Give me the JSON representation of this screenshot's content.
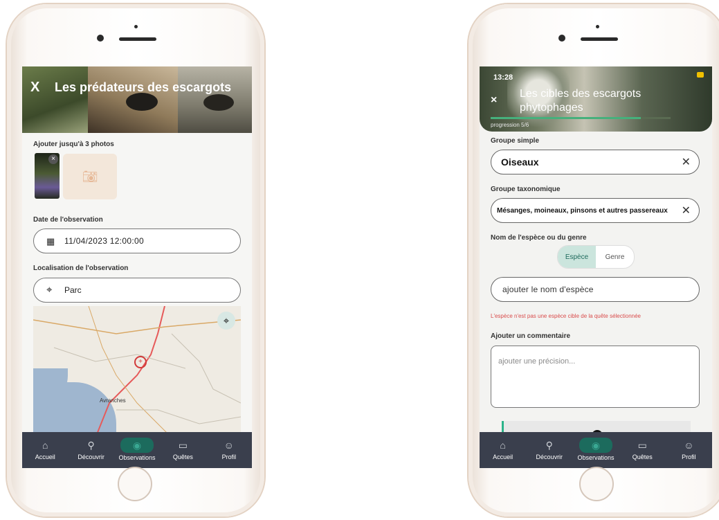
{
  "left_screen": {
    "banner": {
      "close": "X",
      "title": "Les prédateurs des escargots"
    },
    "photos": {
      "label": "Ajouter jusqu'à 3 photos",
      "remove": "×",
      "add_icon": "camera-icon"
    },
    "date": {
      "label": "Date de l'observation",
      "value": "11/04/2023 12:00:00"
    },
    "location": {
      "label": "Localisation de l'observation",
      "value": "Parc"
    },
    "map": {
      "place_label": "Avranches"
    }
  },
  "right_screen": {
    "banner": {
      "time": "13:28",
      "close": "×",
      "title_line1": "Les cibles des escargots",
      "title_line2": "phytophages",
      "progress_label": "progression 5/6",
      "progress_fraction": 0.833
    },
    "simple_group": {
      "label": "Groupe simple",
      "value": "Oiseaux"
    },
    "taxo_group": {
      "label": "Groupe taxonomique",
      "value": "Mésanges, moineaux, pinsons et autres passereaux"
    },
    "species": {
      "label": "Nom de l'espèce ou du genre",
      "toggle_species": "Espèce",
      "toggle_genus": "Genre",
      "placeholder": "ajouter le nom d'espèce",
      "error": "L'espèce n'est pas une espèce cible de la quête sélectionnée"
    },
    "comment": {
      "label": "Ajouter un commentaire",
      "placeholder": "ajouter une précision..."
    }
  },
  "nav": {
    "items": [
      {
        "label": "Accueil",
        "icon": "home-icon"
      },
      {
        "label": "Découvrir",
        "icon": "discover-icon"
      },
      {
        "label": "Observations",
        "icon": "eye-icon"
      },
      {
        "label": "Quêtes",
        "icon": "map-icon"
      },
      {
        "label": "Profil",
        "icon": "user-icon"
      }
    ]
  }
}
